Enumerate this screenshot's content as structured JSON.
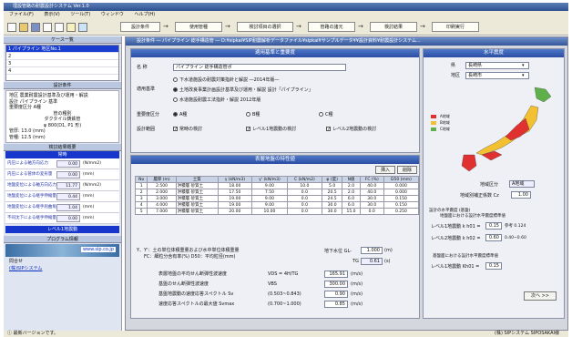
{
  "window": {
    "title": "埋設管路の耐震設計システム Ver.1.0"
  },
  "menu": [
    "ファイル(F)",
    "表示(V)",
    "ツール(T)",
    "ウィンドウ",
    "ヘルプ(H)"
  ],
  "toolbar": {
    "steps": [
      "設計条件",
      "使用管種",
      "検討項目の選択",
      "管路の諸元",
      "検討結果",
      "印刷実行"
    ]
  },
  "sidebar": {
    "case_list_title": "ケース一覧",
    "cases": [
      "1 パイプライン 地区No.1",
      "2",
      "3",
      "4"
    ],
    "design_conditions_title": "設計条件",
    "info_lines": [
      "地区 農業耐震設計基準及び運用・解説",
      "設計 パイプライン 基準",
      "重要度区分 A種",
      "管の種別",
      "ダクタイル鋳鉄管",
      "φ 800(D1, P1 形)",
      "管厚: 13.0 (mm)",
      "管種: 12.5 (mm)"
    ],
    "results_title": "検討結果概要",
    "level1_label": "常時",
    "results": [
      {
        "label": "内圧による軸方向応力",
        "value": "0.00",
        "unit": "(N/mm2)"
      },
      {
        "label": "内圧による管体の変形量",
        "value": "0.00",
        "unit": "(mm)"
      },
      {
        "label": "地盤変位による軸方向応力",
        "value": "11.77",
        "unit": "(N/mm2)"
      },
      {
        "label": "地盤変位による継手伸縮量",
        "value": "0.44",
        "unit": "(mm)"
      },
      {
        "label": "地盤変位による継手屈曲角",
        "value": "1.04",
        "unit": "(mm)"
      },
      {
        "label": "不同沈下による継手伸縮量",
        "value": "0.00",
        "unit": "(mm)"
      }
    ],
    "level2_label": "レベル1地震動",
    "program_info_title": "プログラム情報",
    "url": "www.sip.co.jp",
    "contact_label": "問合せ",
    "company": "(株)SIPシステム"
  },
  "main": {
    "title": "設計条件 ― パイプライン 総手構造管 ― D:¥sipkai¥SIP耐震解析データファイル¥sipkai¥サンプルデータ¥¥設計資料¥耐震設計システム...",
    "standards_head": "適用基準と重要度",
    "name_label": "名 称",
    "name_value": "パイプライン 総手構造管ポ",
    "std_label": "適用基準",
    "std_options": [
      "下水道施設の耐震対策指針と解説 ―2014年版―",
      "土地改良事業計画設計基準及び運用・解説 設計「パイプライン」",
      "水道施設耐震工法指針・解説 2012年版"
    ],
    "importance_label": "重要度区分",
    "importance_options": [
      "A種",
      "B種",
      "C種"
    ],
    "check_label": "設計範囲",
    "check_options": [
      "常時の検討",
      "レベル1地震動の検討",
      "レベル2地震動の検討"
    ],
    "soil_head": "表層地盤の特性値",
    "insert_btn": "挿入",
    "delete_btn": "削除",
    "soil_cols": [
      "No",
      "層厚 (m)",
      "土質",
      "γ (kN/m3)",
      "γ' (kN/m3)",
      "C (kN/m2)",
      "φ (度)",
      "N値",
      "FC (%)",
      "D50 (mm)"
    ],
    "soil_rows": [
      [
        "1",
        "2.500",
        "洪積層 砂質土",
        "18.00",
        "9.00",
        "10.0",
        "5.0",
        "2.0",
        "40.0",
        "0.000"
      ],
      [
        "2",
        "2.000",
        "洪積層 砂質土",
        "17.50",
        "7.50",
        "0.0",
        "20.5",
        "2.0",
        "40.0",
        "0.000"
      ],
      [
        "3",
        "3.000",
        "洪積層 砂質土",
        "19.00",
        "9.00",
        "0.0",
        "24.5",
        "6.0",
        "30.0",
        "0.150"
      ],
      [
        "4",
        "4.000",
        "洪積層 砂質土",
        "19.00",
        "9.00",
        "0.0",
        "30.0",
        "6.0",
        "30.0",
        "0.150"
      ],
      [
        "5",
        "7.000",
        "洪積層 砂質土",
        "20.00",
        "10.00",
        "0.0",
        "30.0",
        "15.0",
        "0.0",
        "0.250"
      ]
    ],
    "soil_note1": "Y、Y'：土の単位体積重量および水中単位体積重量",
    "soil_note2": "FC：細粒分含有率(%) D50：平均粒径(mm)",
    "gl_label": "地下水位 GL-",
    "gl_value": "1.000",
    "gl_unit": "(m)",
    "tg_label": "TG",
    "tg_value": "0.61",
    "tg_unit": "(s)",
    "design_vals": [
      {
        "label": "表層地盤の平均せん断弾性波速度",
        "sym": "VDS = 4H/TG",
        "value": "165.91",
        "unit": "(m/s)"
      },
      {
        "label": "基盤のせん断弾性波速度",
        "sym": "VBS",
        "value": "300.00",
        "unit": "(m/s)"
      },
      {
        "label": "基盤地震動の速度応答スペクトル Sv",
        "sym": "(0.503~0.843)",
        "value": "0.90",
        "unit": "(m/s)"
      },
      {
        "label": "速度応答スペクトルの最大値 Svmax",
        "sym": "(0.700~1.000)",
        "value": "0.85",
        "unit": "(m/s)"
      }
    ],
    "region_head": "水平震度",
    "pref_label": "県",
    "pref_value": "長崎県",
    "area_label": "地区",
    "area_value": "長崎市",
    "legend": [
      "A地域",
      "B地域",
      "C地域"
    ],
    "zone_label": "地域区分",
    "zone_value": "A地域",
    "coef_label": "地域別補正係数 Cz",
    "coef_value": "1.00",
    "k_head1": "設計の水平震度 (基盤)",
    "k_head1b": "地盤面における設計水平震度標準値",
    "k1_label": "レベル1地震動 k h01 =",
    "k1_value": "0.15",
    "k1_note": "参考 0.124",
    "k2_label": "レベル2地震動 k h02 =",
    "k2_value": "0.60",
    "k2_note": "0.40~0.60",
    "k_head2": "基盤面における設計水平震度標準値",
    "k3_label": "レベル1地震動 Kh01 =",
    "k3_value": "0.15",
    "next_btn": "次へ >>"
  },
  "status": {
    "left": "最新バージョンです。",
    "right": "(株) SIPシステム  SIPOSAKAI様"
  }
}
